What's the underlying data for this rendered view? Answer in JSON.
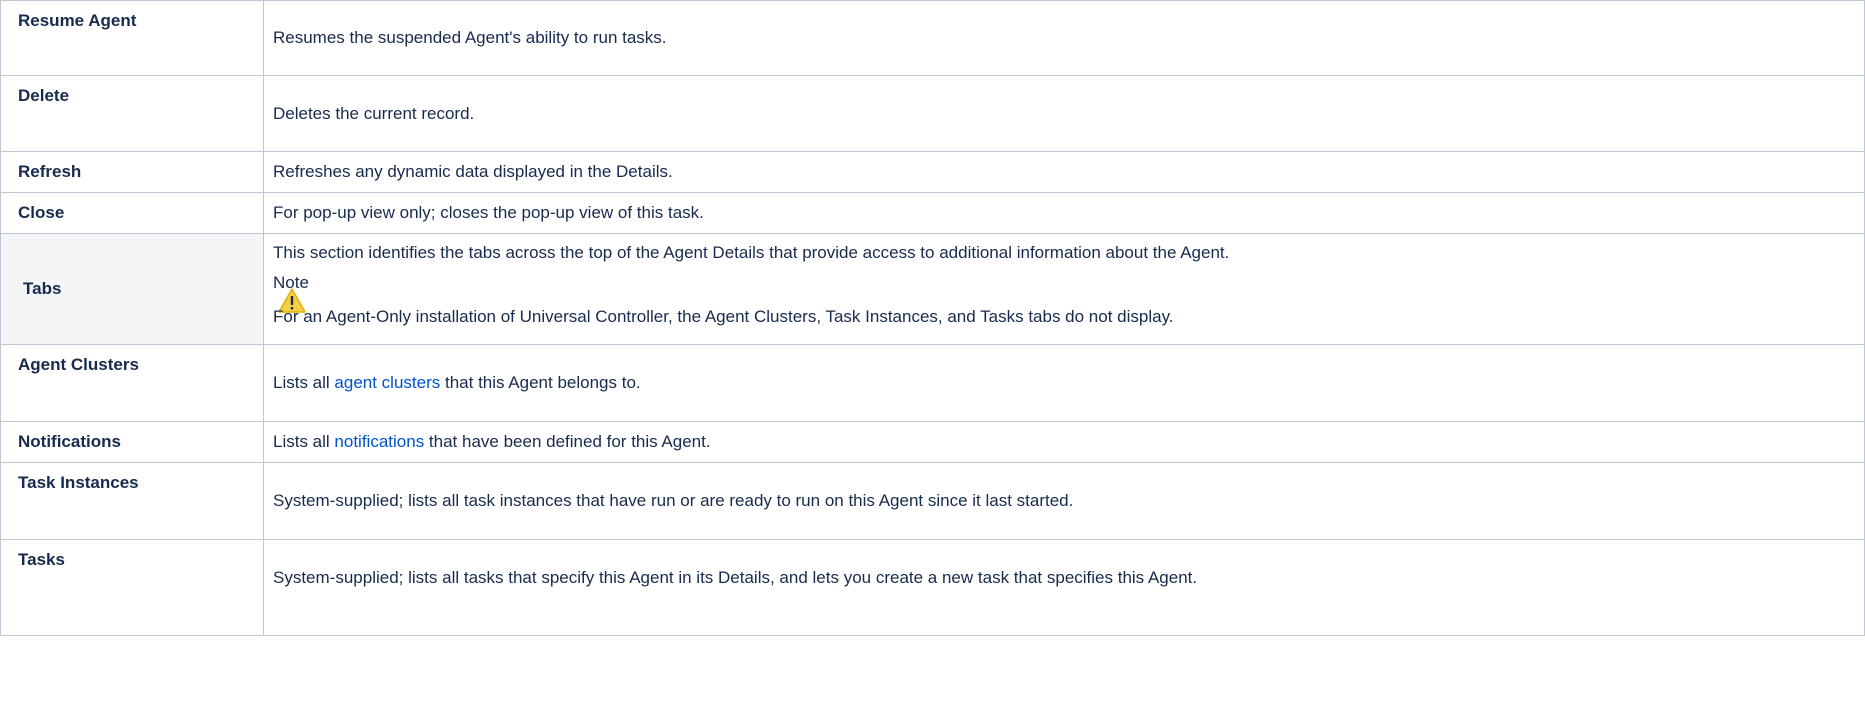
{
  "rows": [
    {
      "term": "Resume Agent",
      "desc": "Resumes the suspended Agent's ability to run tasks."
    },
    {
      "term": "Delete",
      "desc": "Deletes the current record."
    },
    {
      "term": "Refresh",
      "desc": "Refreshes any dynamic data displayed in the Details."
    },
    {
      "term": "Close",
      "desc": "For pop-up view only; closes the pop-up view of this task."
    },
    {
      "term": "Tabs",
      "desc": "This section identifies the tabs across the top of the Agent Details that provide access to additional information about the Agent.",
      "note_title": "Note",
      "note_text": "For an Agent-Only installation of Universal Controller, the Agent Clusters, Task Instances, and Tasks tabs do not display."
    },
    {
      "term": "Agent Clusters",
      "desc_pre": "Lists all ",
      "link": "agent clusters",
      "desc_post": " that this Agent belongs to."
    },
    {
      "term": "Notifications",
      "desc_pre": "Lists all ",
      "link": "notifications",
      "desc_post": " that have been defined for this Agent."
    },
    {
      "term": "Task Instances",
      "desc": "System-supplied; lists all task instances that have run or are ready to run on this Agent since it last started."
    },
    {
      "term": "Tasks",
      "desc": "System-supplied; lists all tasks that specify this Agent in its Details, and lets you create a new task that specifies this Agent."
    }
  ],
  "colors": {
    "border": "#c1c7d0",
    "link": "#0052cc",
    "header_bg": "#f4f5f7",
    "warning": "#f5cd47"
  },
  "icons": {
    "note": "warning-icon"
  }
}
